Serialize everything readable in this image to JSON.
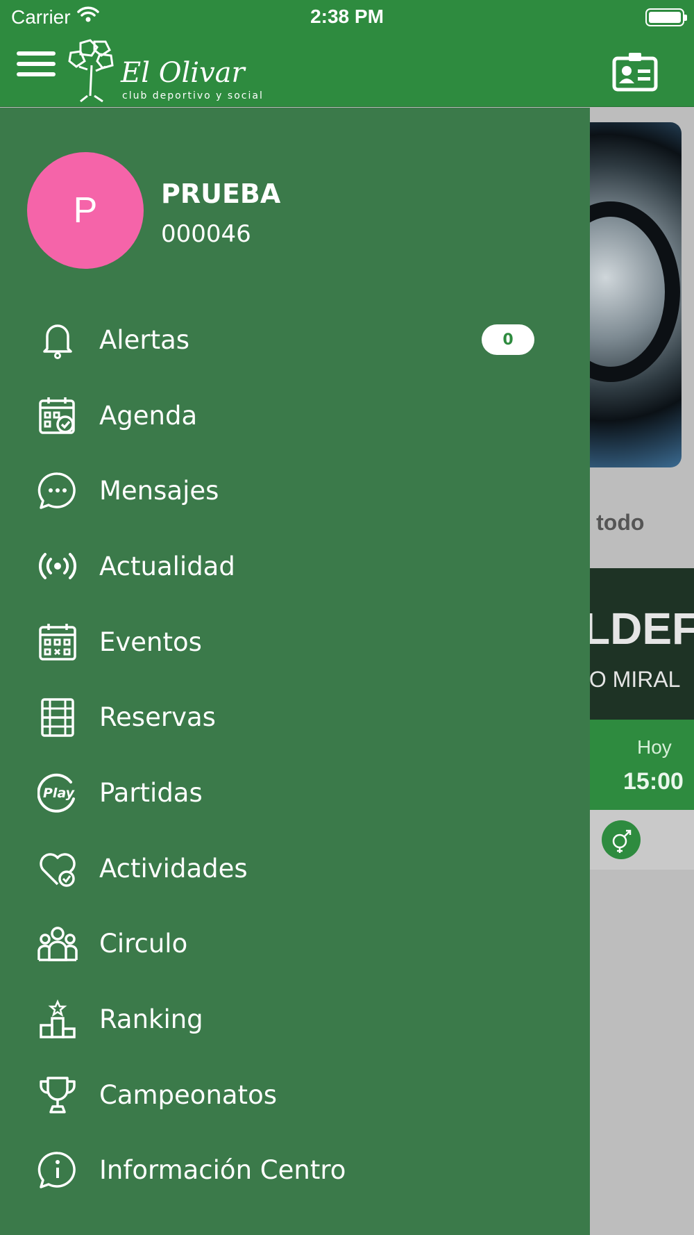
{
  "status_bar": {
    "carrier": "Carrier",
    "time": "2:38 PM"
  },
  "header": {
    "logo_title": "El Olivar",
    "logo_subtitle": "club deportivo y social"
  },
  "user": {
    "initial": "P",
    "name": "PRUEBA",
    "id": "000046"
  },
  "menu": [
    {
      "label": "Alertas",
      "icon": "bell-icon",
      "badge": "0"
    },
    {
      "label": "Agenda",
      "icon": "calendar-check-icon"
    },
    {
      "label": "Mensajes",
      "icon": "chat-bubble-icon"
    },
    {
      "label": "Actualidad",
      "icon": "broadcast-icon"
    },
    {
      "label": "Eventos",
      "icon": "calendar-grid-icon"
    },
    {
      "label": "Reservas",
      "icon": "court-icon"
    },
    {
      "label": "Partidas",
      "icon": "play-icon"
    },
    {
      "label": "Actividades",
      "icon": "heart-check-icon"
    },
    {
      "label": "Circulo",
      "icon": "group-icon"
    },
    {
      "label": "Ranking",
      "icon": "podium-icon"
    },
    {
      "label": "Campeonatos",
      "icon": "trophy-icon"
    },
    {
      "label": "Información Centro",
      "icon": "info-chat-icon"
    }
  ],
  "background": {
    "link_partial": "er todo",
    "banner_big": "LDEF",
    "banner_small": "IO MIRAL",
    "day": "Hoy",
    "time": "15:00"
  },
  "colors": {
    "primary_green": "#2e8b3f",
    "drawer_green": "#3b7a4a",
    "avatar_pink": "#f564a9"
  }
}
